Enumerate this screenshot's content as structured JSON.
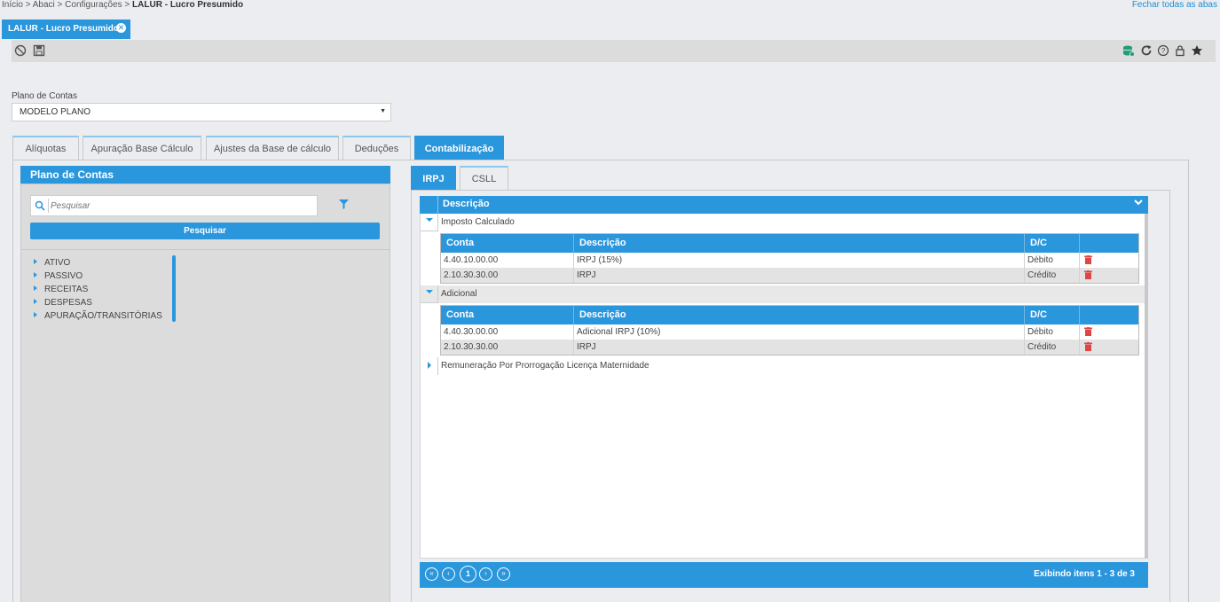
{
  "breadcrumb": {
    "path": "Início > Abaci > Configurações > ",
    "current": "LALUR - Lucro Presumido"
  },
  "close_all_tabs": "Fechar todas as abas",
  "window_tab": {
    "label": "LALUR - Lucro Presumido"
  },
  "plano_de_contas": {
    "label": "Plano de Contas",
    "selected": "MODELO PLANO"
  },
  "tabs": [
    "Alíquotas",
    "Apuração Base Cálculo",
    "Ajustes da Base de cálculo",
    "Deduções",
    "Contabilização"
  ],
  "left_panel": {
    "title": "Plano de Contas",
    "search_placeholder": "Pesquisar",
    "search_button": "Pesquisar",
    "tree": [
      "ATIVO",
      "PASSIVO",
      "RECEITAS",
      "DESPESAS",
      "APURAÇÃO/TRANSITÓRIAS"
    ]
  },
  "subtabs": [
    "IRPJ",
    "CSLL"
  ],
  "grid": {
    "header": "Descrição",
    "columns": [
      "Conta",
      "Descrição",
      "D/C"
    ],
    "groups": [
      {
        "label": "Imposto Calculado",
        "rows": [
          {
            "conta": "4.40.10.00.00",
            "descricao": "IRPJ (15%)",
            "dc": "Débito"
          },
          {
            "conta": "2.10.30.30.00",
            "descricao": "IRPJ",
            "dc": "Crédito"
          }
        ]
      },
      {
        "label": "Adicional",
        "rows": [
          {
            "conta": "4.40.30.00.00",
            "descricao": "Adicional IRPJ (10%)",
            "dc": "Débito"
          },
          {
            "conta": "2.10.30.30.00",
            "descricao": "IRPJ",
            "dc": "Crédito"
          }
        ]
      },
      {
        "label": "Remuneração Por Prorrogação Licença Maternidade",
        "rows": []
      }
    ]
  },
  "pager": {
    "current_page": "1",
    "info": "Exibindo itens 1 - 3 de 3"
  },
  "colors": {
    "accent": "#2a96dc",
    "delete": "#e04545"
  }
}
